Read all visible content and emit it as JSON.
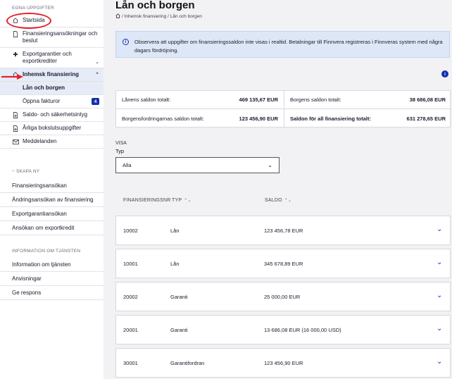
{
  "sidebar": {
    "section_own": "EGNA UPPGIFTER",
    "items": [
      {
        "label": "Startsida",
        "icon": "home-icon"
      },
      {
        "label": "Finansieringsansökningar och beslut",
        "icon": "document-icon"
      },
      {
        "label": "Exportgarantier och exportkrediter",
        "icon": "arrows-icon"
      },
      {
        "label": "Inhemsk finansiering",
        "icon": "home-icon"
      },
      {
        "label": "Lån och borgen"
      },
      {
        "label": "Öppna fakturor",
        "badge": "4"
      },
      {
        "label": "Saldo- och säkerhetsintyg",
        "icon": "document-plus-icon"
      },
      {
        "label": "Årliga bokslutsuppgifter",
        "icon": "document-plus-icon"
      },
      {
        "label": "Meddelanden",
        "icon": "envelope-icon"
      }
    ],
    "section_create": "SKAPA NY",
    "create_items": [
      "Finansieringsansökan",
      "Ändringsansökan av finansiering",
      "Exportgarantiansökan",
      "Ansökan om exportkredit"
    ],
    "section_info": "INFORMATION OM TJÄNSTEN",
    "info_items": [
      "Information om tjänsten",
      "Anvisningar",
      "Ge respons"
    ]
  },
  "main": {
    "title": "Lån och borgen",
    "breadcrumb": "/ Inhemsk finansiering / Lån och borgen",
    "info_text": "Observera att uppgifter om finansieringssaldon inte visas i realtid. Betalningar till Finnvera registreras i Finnveras system med några dagars fördröjning.",
    "totals": {
      "loans_label": "Lånens saldon totalt:",
      "loans_value": "469 135,67 EUR",
      "guarantees_label": "Borgens saldon totalt:",
      "guarantees_value": "38 686,08 EUR",
      "receivables_label": "Borgensfordringarnas saldon totalt:",
      "receivables_value": "123 456,90 EUR",
      "all_label": "Saldon för all finansiering totalt:",
      "all_value": "631 278,65 EUR"
    },
    "filter": {
      "visa_label": "VISA",
      "type_label": "Typ",
      "selected": "Alla"
    },
    "table": {
      "headers": [
        "FINANSIERINGSNR",
        "TYP",
        "SALDO"
      ],
      "rows": [
        {
          "nr": "10002",
          "type": "Lån",
          "balance": "123 456,78 EUR"
        },
        {
          "nr": "10001",
          "type": "Lån",
          "balance": "345 678,89 EUR"
        },
        {
          "nr": "20002",
          "type": "Garanti",
          "balance": "25 000,00 EUR"
        },
        {
          "nr": "20001",
          "type": "Garanti",
          "balance": "13 686,08 EUR (16 000,00 USD)"
        },
        {
          "nr": "30001",
          "type": "Garantifordran",
          "balance": "123 456,90 EUR"
        }
      ]
    }
  },
  "colors": {
    "accent": "#1230ae",
    "highlight": "#e5212d",
    "info_bg": "#dde7f7",
    "active_bg": "#e6ecf7"
  }
}
